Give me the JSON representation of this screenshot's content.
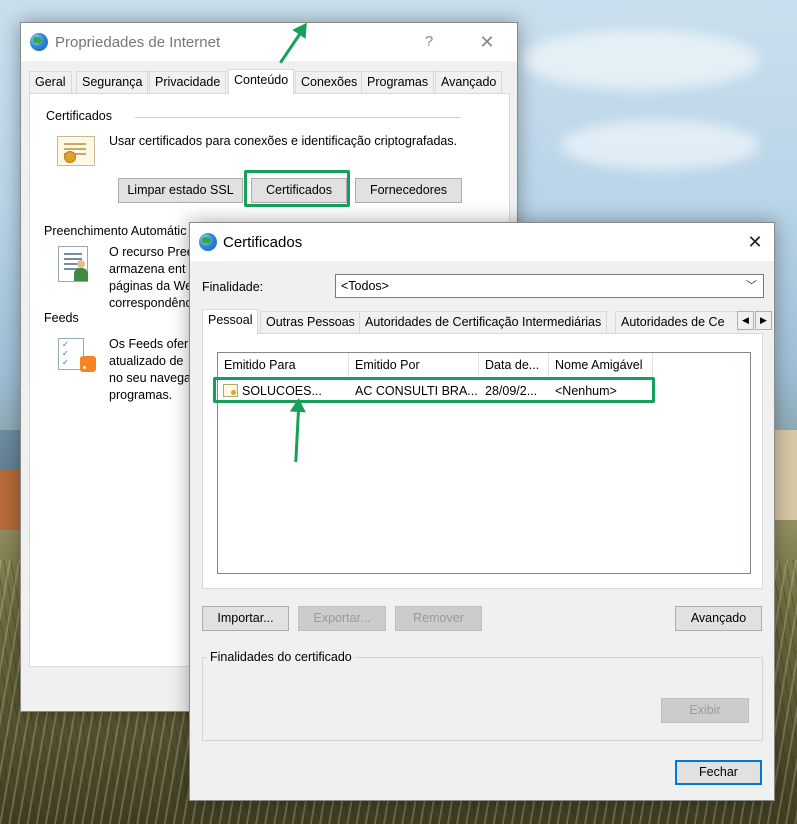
{
  "colors": {
    "highlight": "#16a05a",
    "accent": "#0078d7"
  },
  "internet_properties": {
    "title": "Propriedades de Internet",
    "help_label": "?",
    "close_label": "✕",
    "tabs": [
      "Geral",
      "Segurança",
      "Privacidade",
      "Conteúdo",
      "Conexões",
      "Programas",
      "Avançado"
    ],
    "active_tab": "Conteúdo",
    "certificates": {
      "heading": "Certificados",
      "description": "Usar certificados para conexões e identificação criptografadas.",
      "clear_ssl_button": "Limpar estado SSL",
      "certificates_button": "Certificados",
      "publishers_button": "Fornecedores"
    },
    "autocomplete": {
      "heading": "Preenchimento Automátic",
      "lines": [
        "O recurso Pree",
        "armazena ent",
        "páginas da We",
        "correspondênc"
      ]
    },
    "feeds": {
      "heading": "Feeds",
      "lines": [
        "Os Feeds ofer",
        "atualizado de",
        "no seu navega",
        "programas."
      ]
    }
  },
  "certificates_dialog": {
    "title": "Certificados",
    "close_label": "✕",
    "purpose_label": "Finalidade:",
    "purpose_value": "<Todos>",
    "tabs": [
      "Pessoal",
      "Outras Pessoas",
      "Autoridades de Certificação Intermediárias",
      "Autoridades de Ce"
    ],
    "active_tab": "Pessoal",
    "columns": [
      "Emitido Para",
      "Emitido Por",
      "Data de...",
      "Nome Amigável"
    ],
    "rows": [
      {
        "issued_to": "SOLUCOES...",
        "issued_by": "AC CONSULTI BRA...",
        "date": "28/09/2...",
        "friendly_name": "<Nenhum>"
      }
    ],
    "import_button": "Importar...",
    "export_button": "Exportar...",
    "remove_button": "Remover",
    "advanced_button": "Avançado",
    "purposes_group": "Finalidades do certificado",
    "view_button": "Exibir",
    "close_button": "Fechar"
  }
}
